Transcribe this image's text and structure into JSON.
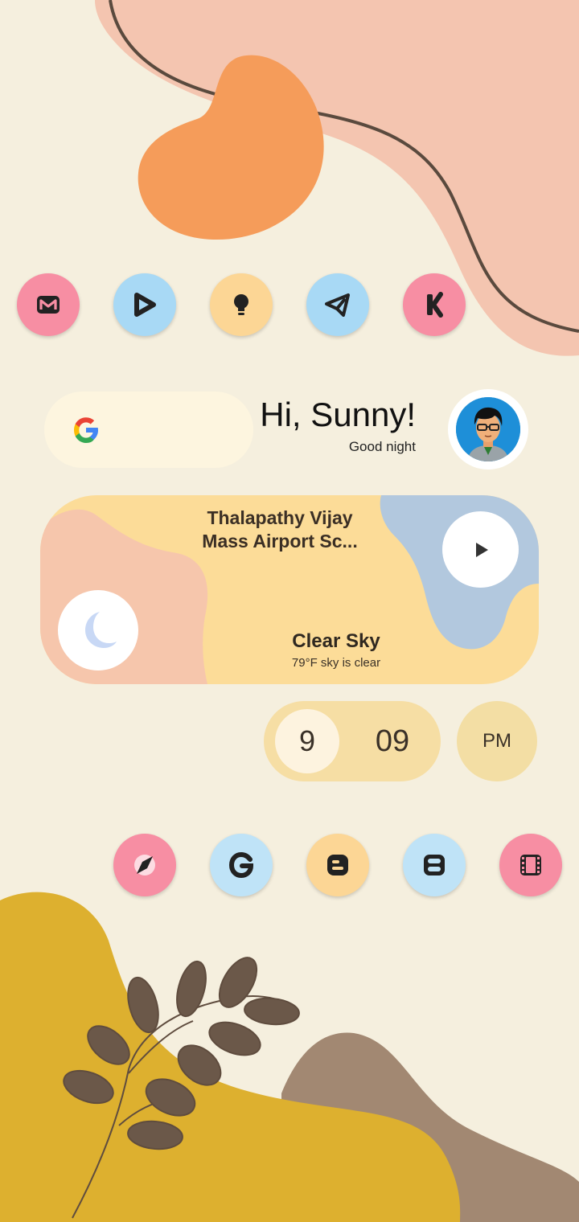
{
  "top_dock": [
    {
      "icon": "gmail-icon",
      "color": "#f78ea3"
    },
    {
      "icon": "play-store-icon",
      "color": "#a8d9f5"
    },
    {
      "icon": "lightbulb-icon",
      "color": "#fcd695"
    },
    {
      "icon": "telegram-icon",
      "color": "#a8d9f5"
    },
    {
      "icon": "kwgt-icon",
      "color": "#f78ea3"
    }
  ],
  "search": {
    "logo": "google-g-icon"
  },
  "greeting": {
    "title": "Hi, Sunny!",
    "subtitle": "Good night"
  },
  "media": {
    "title_line1": "Thalapathy Vijay",
    "title_line2": "Mass Airport Sc...",
    "weather_condition": "Clear Sky",
    "weather_detail": "79°F sky is clear"
  },
  "clock": {
    "hour": "9",
    "minute": "09",
    "ampm": "PM"
  },
  "bottom_dock": [
    {
      "icon": "compass-icon",
      "color": "#f78ea3"
    },
    {
      "icon": "google-search-icon",
      "color": "#bfe3f7"
    },
    {
      "icon": "blogger-icon",
      "color": "#fcd695"
    },
    {
      "icon": "dashboard-icon",
      "color": "#bfe3f7"
    },
    {
      "icon": "film-icon",
      "color": "#f78ea3"
    }
  ],
  "colors": {
    "background": "#f5efde",
    "peach": "#f4c5b0",
    "orange": "#f49c5a",
    "mustard": "#ddb02f",
    "brown": "#a28872",
    "leaf": "#6b5849",
    "icon_dark": "#222222"
  }
}
